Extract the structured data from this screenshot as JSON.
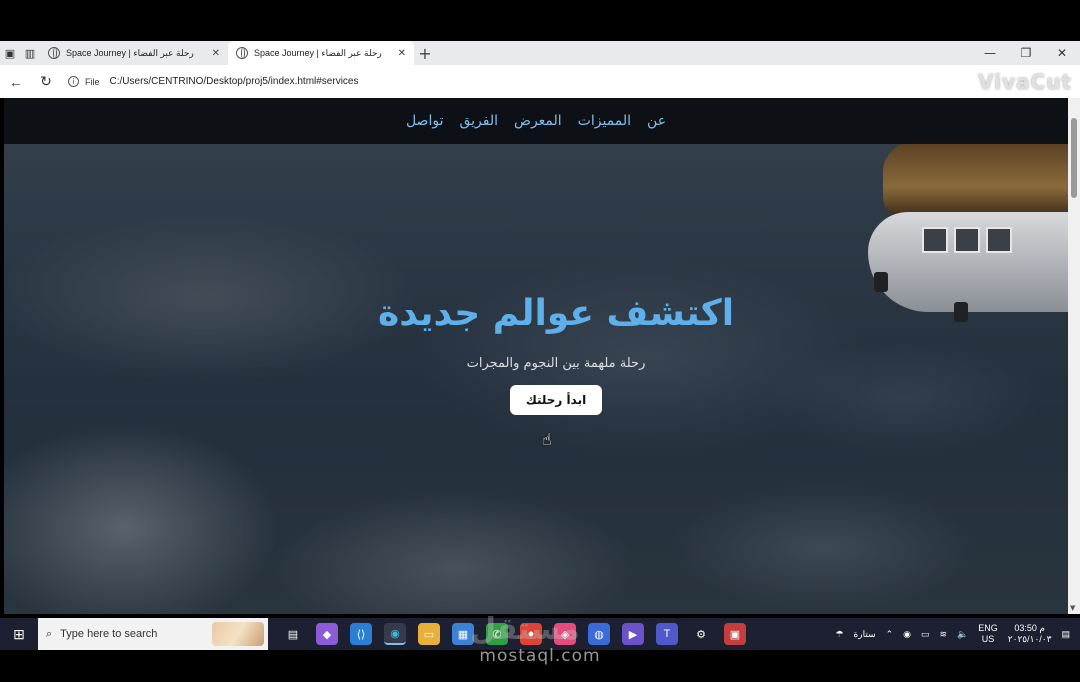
{
  "browser": {
    "tabs": [
      {
        "title": "Space Journey | رحلة عبر الفضاء",
        "active": false
      },
      {
        "title": "Space Journey | رحلة عبر الفضاء",
        "active": true
      }
    ],
    "new_tab_symbol": "+",
    "address": {
      "file_label": "File",
      "url": "C:/Users/CENTRINO/Desktop/proj5/index.html#services"
    },
    "overlay_logo": "VivaCut"
  },
  "page": {
    "nav": [
      "عن",
      "المميزات",
      "المعرض",
      "الفريق",
      "تواصل"
    ],
    "hero": {
      "title": "اكتشف عوالم جديدة",
      "subtitle": "رحلة ملهمة بين النجوم والمجرات",
      "button": "ابدأ رحلتك"
    }
  },
  "taskbar": {
    "search_placeholder": "Type here to search",
    "weather_label": "ستارة",
    "language": "ENG",
    "region": "US",
    "time": "03:50 م",
    "date": "٢٠٢٥/١٠/٠٣",
    "accent": "#7fbff0"
  },
  "watermark": {
    "text": "mostaql.com",
    "arabic": "مستقل"
  }
}
